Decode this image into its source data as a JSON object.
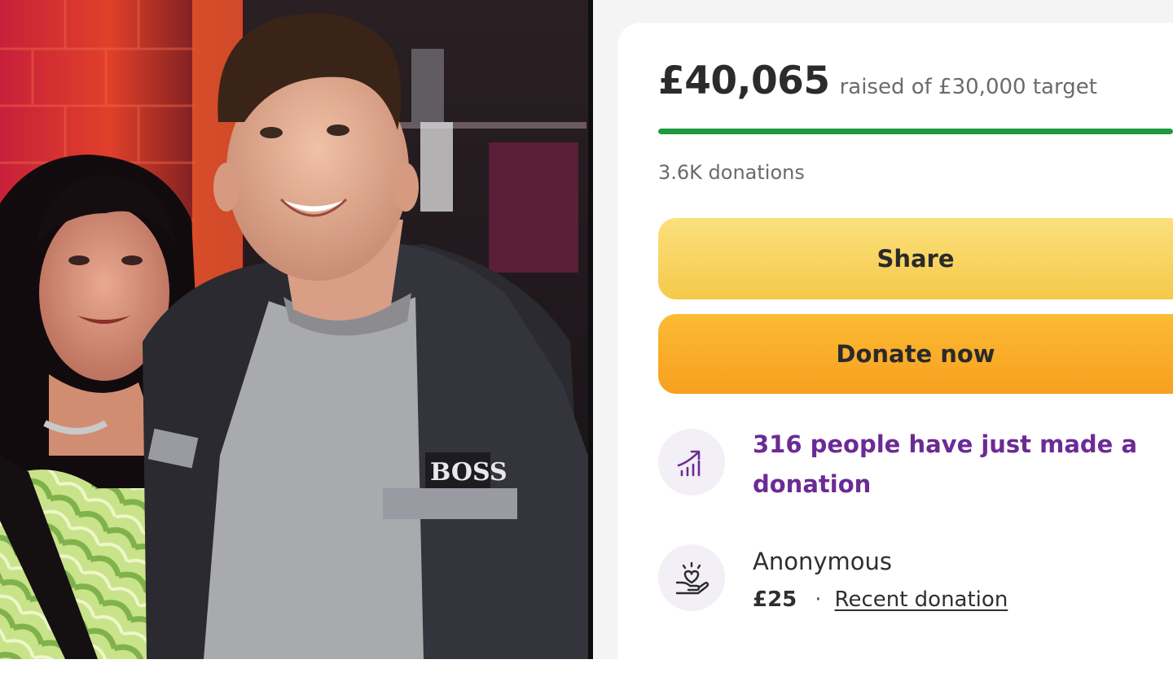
{
  "fundraiser": {
    "amount_raised": "£40,065",
    "target_text": "raised of £30,000 target",
    "progress_fraction": 1.0,
    "donations_count": "3.6K donations"
  },
  "buttons": {
    "share_label": "Share",
    "donate_label": "Donate now"
  },
  "activity": {
    "trend_text": "316 people have just made a donation",
    "trend_icon": "trending-up-icon"
  },
  "recent_donation": {
    "donor": "Anonymous",
    "amount": "£25",
    "separator": "·",
    "link_label": "Recent donation",
    "icon": "heart-hand-icon"
  },
  "photo": {
    "shirt_logo_text": "BOSS"
  },
  "colors": {
    "progress": "#1f9a3e",
    "share_button": "#f5c94a",
    "donate_button": "#f7a020",
    "trend_text": "#6c2a95",
    "icon_bg": "#f2eff6"
  }
}
